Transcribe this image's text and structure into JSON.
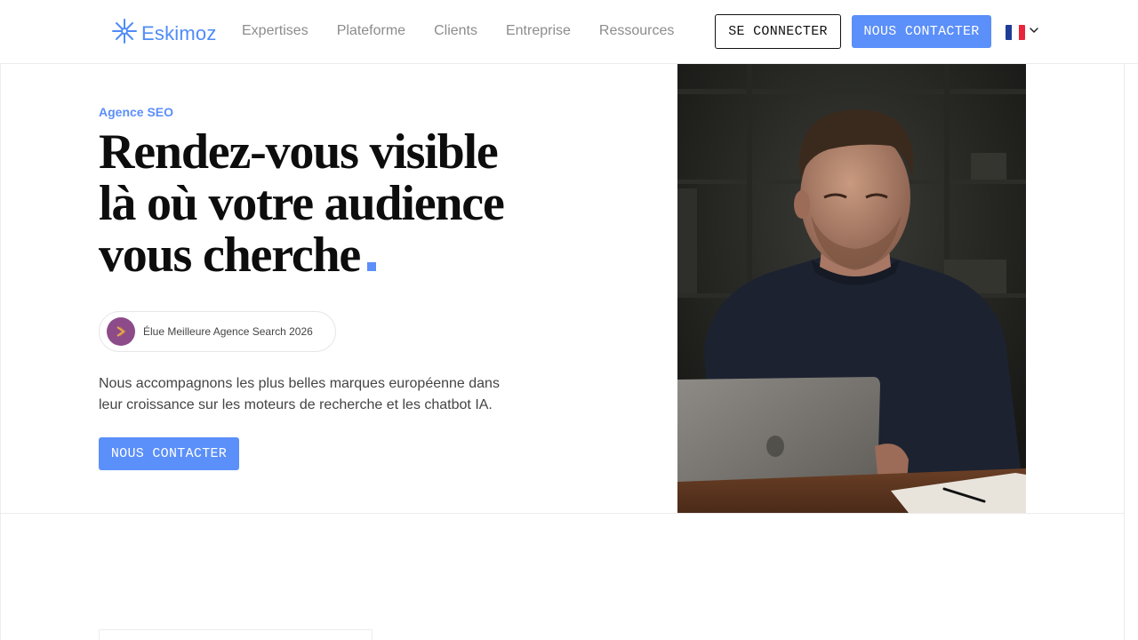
{
  "brand": {
    "name": "Eskimoz",
    "accent": "#5b8ff9"
  },
  "nav": {
    "items": [
      {
        "label": "Expertises"
      },
      {
        "label": "Plateforme"
      },
      {
        "label": "Clients"
      },
      {
        "label": "Entreprise"
      },
      {
        "label": "Ressources"
      }
    ]
  },
  "header": {
    "login_label": "SE CONNECTER",
    "contact_label": "NOUS CONTACTER",
    "language": {
      "icon": "flag-fr-icon",
      "chevron": "chevron-down-icon"
    }
  },
  "hero": {
    "eyebrow": "Agence SEO",
    "headline_line1": "Rendez-vous visible",
    "headline_line2": "là où votre audience",
    "headline_line3": "vous cherche",
    "award_text": "Élue Meilleure Agence Search 2026",
    "description": "Nous accompagnons les plus belles marques européenne dans leur croissance sur les moteurs de recherche et les chatbot IA.",
    "cta_label": "NOUS CONTACTER"
  }
}
